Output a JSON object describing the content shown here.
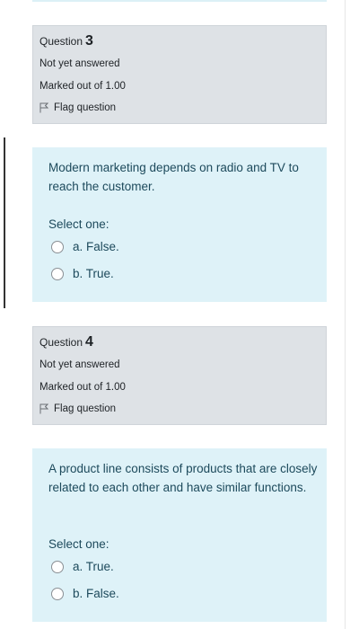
{
  "questions": [
    {
      "label": "Question",
      "number": "3",
      "state": "Not yet answered",
      "grade": "Marked out of 1.00",
      "flag": "Flag question",
      "text": "Modern marketing depends on radio and TV to reach the customer.",
      "prompt": "Select one:",
      "answers": [
        "a. False.",
        "b. True."
      ]
    },
    {
      "label": "Question",
      "number": "4",
      "state": "Not yet answered",
      "grade": "Marked out of 1.00",
      "flag": "Flag question",
      "text": "A product line consists of products that are closely related to each other and have similar functions.",
      "prompt": "Select one:",
      "answers": [
        "a. True.",
        "b. False."
      ]
    }
  ],
  "colors": {
    "info_bg": "#dee2e6",
    "content_bg": "#def2f8",
    "content_text": "#1d4a5c"
  },
  "icons": [
    "flag-icon",
    "radio-icon"
  ]
}
